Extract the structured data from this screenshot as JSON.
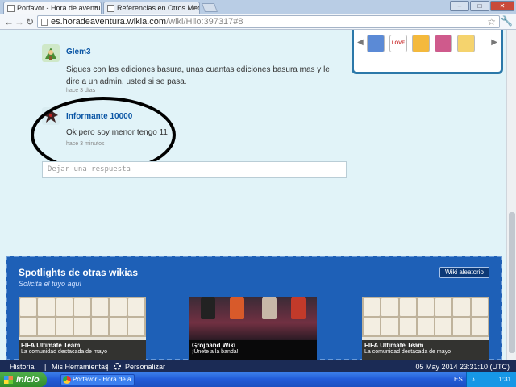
{
  "browser": {
    "tabs": [
      {
        "title": "Porfavor - Hora de aventura",
        "active": true
      },
      {
        "title": "Referencias en Otros Medios",
        "active": false
      }
    ],
    "window_buttons": [
      "–",
      "□",
      "✕"
    ],
    "url_domain": "es.horadeaventura.wikia.com",
    "url_path": "/wiki/Hilo:397317#8",
    "back_icon": "←",
    "forward_icon": "→",
    "reload_icon": "↻",
    "star_icon": "☆",
    "wrench_icon": "🔧"
  },
  "thread": {
    "comments": [
      {
        "author": "Glem3",
        "text": "Sigues con las ediciones basura, unas cuantas ediciones basura mas y le dire a un admin, usted si se pasa.",
        "time": "hace 3 días"
      },
      {
        "author": "Informante 10000",
        "text": "Ok pero soy menor tengo 11",
        "time": "hace 3 minutos"
      }
    ],
    "reply_placeholder": "Dejar una respuesta"
  },
  "sidebar_box": {
    "thumb_labels": [
      "",
      "LOVE",
      "",
      "",
      ""
    ],
    "thumb_colors": [
      "#5b8ad6",
      "#ffffff",
      "#f4b93c",
      "#cf5a8c",
      "#f5d36d"
    ],
    "arrow_left": "◀",
    "arrow_right": "▶"
  },
  "spotlights": {
    "title": "Spotlights de otras wikias",
    "subtitle": "Solicita el tuyo aquí",
    "random_button": "Wiki aleatorio",
    "cards": [
      {
        "title": "FIFA Ultimate Team",
        "subtitle": "La comunidad destacada de mayo"
      },
      {
        "title": "Grojband Wiki",
        "subtitle": "¡Únete a la banda!"
      },
      {
        "title": "FIFA Ultimate Team",
        "subtitle": "La comunidad destacada de mayo"
      }
    ]
  },
  "wikia_toolbar": {
    "historial": "Historial",
    "mis_herramientas": "Mis Herramientas",
    "personalizar": "Personalizar",
    "datetime": "05 May 2014 23:31:10 (UTC)"
  },
  "taskbar": {
    "start_label": "Inicio",
    "task_item": "Porfavor - Hora de a...",
    "language": "ES",
    "clock": "1:31"
  }
}
